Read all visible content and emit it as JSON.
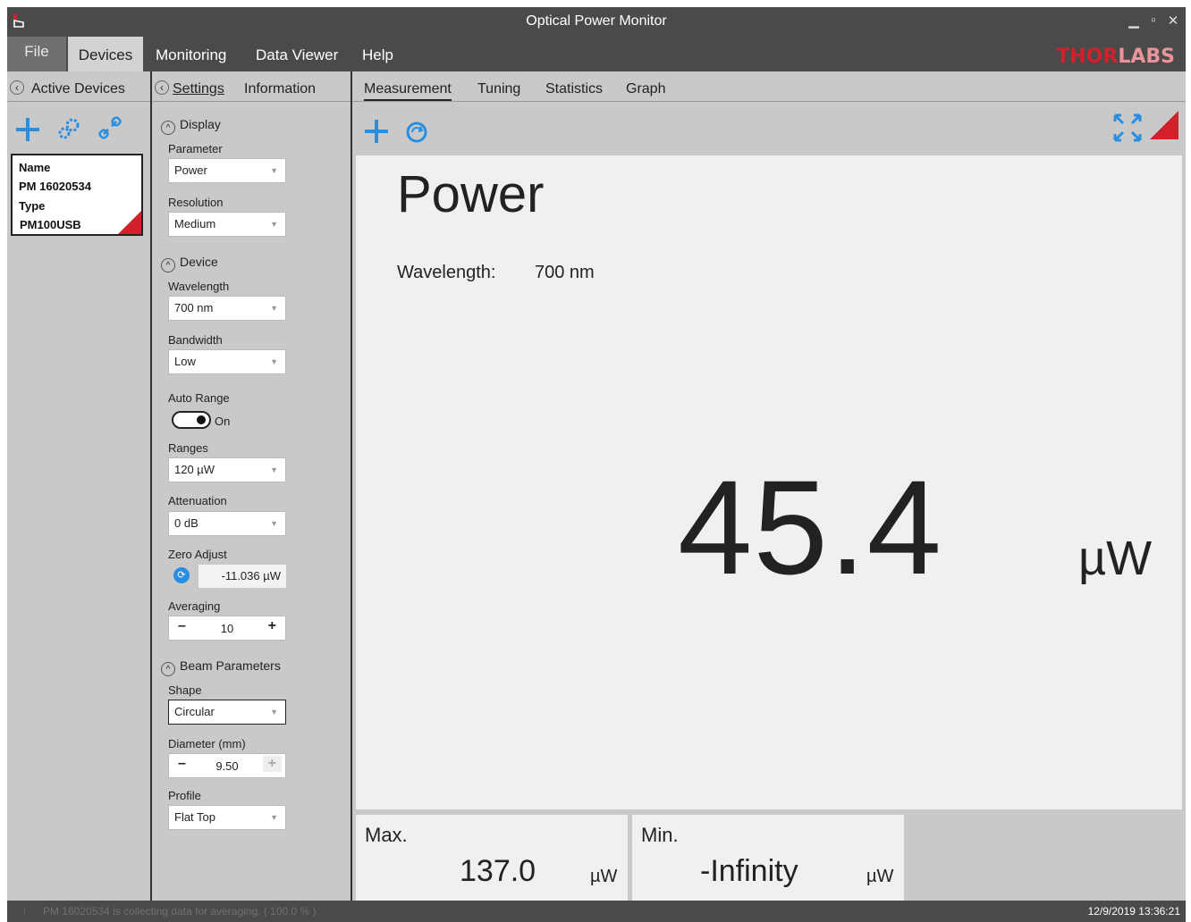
{
  "window": {
    "title": "Optical Power Monitor"
  },
  "menu": {
    "file": "File",
    "devices": "Devices",
    "monitoring": "Monitoring",
    "data_viewer": "Data Viewer",
    "help": "Help"
  },
  "logo": {
    "part1": "THOR",
    "part2": "LABS"
  },
  "devices_panel": {
    "title": "Active Devices",
    "card": {
      "name_label": "Name",
      "name_value": "PM 16020534",
      "type_label": "Type",
      "type_value": "PM100USB"
    }
  },
  "settings_panel": {
    "tabs": [
      "Settings",
      "Information"
    ],
    "display_section": "Display",
    "parameter_label": "Parameter",
    "parameter_value": "Power",
    "resolution_label": "Resolution",
    "resolution_value": "Medium",
    "device_section": "Device",
    "wavelength_label": "Wavelength",
    "wavelength_value": "700 nm",
    "bandwidth_label": "Bandwidth",
    "bandwidth_value": "Low",
    "auto_range_label": "Auto Range",
    "auto_range_state": "On",
    "ranges_label": "Ranges",
    "ranges_value": "120 µW",
    "attenuation_label": "Attenuation",
    "attenuation_value": "0 dB",
    "zero_adjust_label": "Zero Adjust",
    "zero_adjust_value": "-11.036 µW",
    "averaging_label": "Averaging",
    "averaging_value": "10",
    "beam_section": "Beam Parameters",
    "shape_label": "Shape",
    "shape_value": "Circular",
    "diameter_label": "Diameter (mm)",
    "diameter_value": "9.50",
    "profile_label": "Profile",
    "profile_value": "Flat Top"
  },
  "main_panel": {
    "tabs": [
      "Measurement",
      "Tuning",
      "Statistics",
      "Graph"
    ],
    "parameter_title": "Power",
    "wavelength_label": "Wavelength:",
    "wavelength_value": "700 nm",
    "value": "45.4",
    "unit": "µW",
    "max": {
      "label": "Max.",
      "value": "137.0",
      "unit": "µW"
    },
    "min": {
      "label": "Min.",
      "value": "-Infinity",
      "unit": "µW"
    }
  },
  "statusbar": {
    "message": "PM 16020534 is collecting data for averaging. ( 100.0 % )",
    "datetime": "12/9/2019 13:36:21"
  },
  "colors": {
    "accent": "#2a8ee0",
    "brand": "#d4202a",
    "chrome": "#4a4a4a",
    "panel": "#c9c9c9"
  }
}
